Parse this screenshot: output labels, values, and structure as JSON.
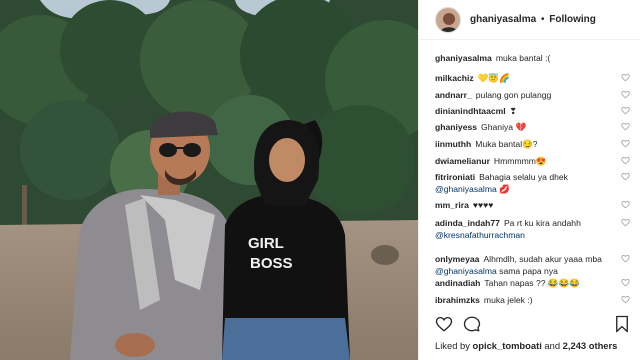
{
  "header": {
    "username": "ghaniyasalma",
    "separator": "•",
    "follow_status": "Following"
  },
  "caption": {
    "user": "ghaniyasalma",
    "text": "muka bantal :("
  },
  "comments": [
    {
      "user": "milkachiz",
      "text": "💛😇🌈"
    },
    {
      "user": "andnarr_",
      "text": "pulang gon pulangg"
    },
    {
      "user": "dinianindhtaacml",
      "text": "❣"
    },
    {
      "user": "ghaniyess",
      "text": "Ghaniya 💔"
    },
    {
      "user": "iinmuthh",
      "text": "Muka bantal😏?"
    },
    {
      "user": "dwiamelianur",
      "text": "Hmmmmm😍"
    },
    {
      "user": "fitrironiati",
      "text": "Bahagia selalu ya dhek",
      "mention": "@ghaniyasalma",
      "after": " 💋"
    },
    {
      "user": "mm_rira",
      "text": "♥♥♥♥"
    },
    {
      "user": "adinda_indah77",
      "text": "Pa rt ku kira andahh",
      "mention": "@kresnafathurrachman",
      "after": ""
    },
    {
      "user": "onlymeyaa",
      "text": "Alhmdlh, sudah akur yaaa mba",
      "mention": "@ghaniyasalma",
      "after": " sama papa nya"
    },
    {
      "user": "andinadiah",
      "text": "Tahan napas ?? 😂😂😂"
    },
    {
      "user": "ibrahimzks",
      "text": "muka jelek :)"
    }
  ],
  "footer": {
    "liked_prefix": "Liked by ",
    "liked_user": "opick_tomboati",
    "liked_middle": " and ",
    "liked_count": "2,243 others"
  },
  "photo": {
    "shirt_text_line1": "GIRL",
    "shirt_text_line2": "BOSS"
  },
  "icons": [
    "heart-icon",
    "comment-icon",
    "bookmark-icon"
  ],
  "colors": {
    "link": "#003569",
    "border": "#efefef",
    "text": "#262626"
  }
}
